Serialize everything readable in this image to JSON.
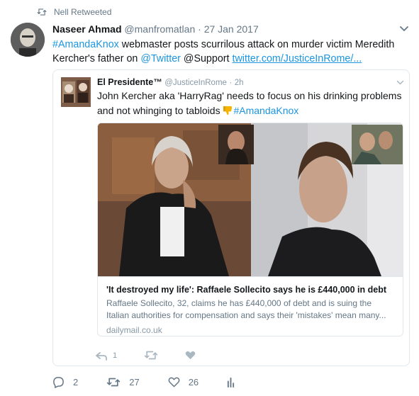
{
  "retweet_line": {
    "label": "Nell Retweeted"
  },
  "tweet": {
    "author_name": "Naseer Ahmad",
    "author_handle": "@manfromatlan",
    "separator": "·",
    "date": "27 Jan 2017",
    "text_parts": {
      "hashtag": "#AmandaKnox",
      "text1": " webmaster posts scurrilous attack on murder victim Meredith Kercher's father on ",
      "mention_twitter": "@Twitter",
      "text2": " @Support ",
      "link": "twitter.com/JusticeInRome/..."
    },
    "reply_count": "2",
    "retweet_count": "27",
    "like_count": "26"
  },
  "quoted_tweet": {
    "author_name": "El Presidente™",
    "author_handle": "@JusticeInRome",
    "separator": "·",
    "time": "2h",
    "text1": "John Kercher aka 'HarryRag' needs to focus on his drinking problems and not whinging to tabloids",
    "hashtag": "#AmandaKnox",
    "reply_count": "1",
    "card": {
      "title": "'It destroyed my life': Raffaele Sollecito says he is £440,000 in debt",
      "description": "Raffaele Sollecito, 32, claims he has £440,000 of debt and is suing the Italian authorities for compensation and says their 'mistakes' mean many...",
      "domain": "dailymail.co.uk"
    }
  },
  "colors": {
    "link": "#1b95e0",
    "muted": "#657786",
    "border": "#e1e8ed",
    "emoji": "#f4b400"
  },
  "icons": [
    "retweet-icon",
    "chevron-down-icon",
    "reply-icon",
    "like-icon",
    "analytics-icon",
    "thumbs-down-emoji"
  ]
}
